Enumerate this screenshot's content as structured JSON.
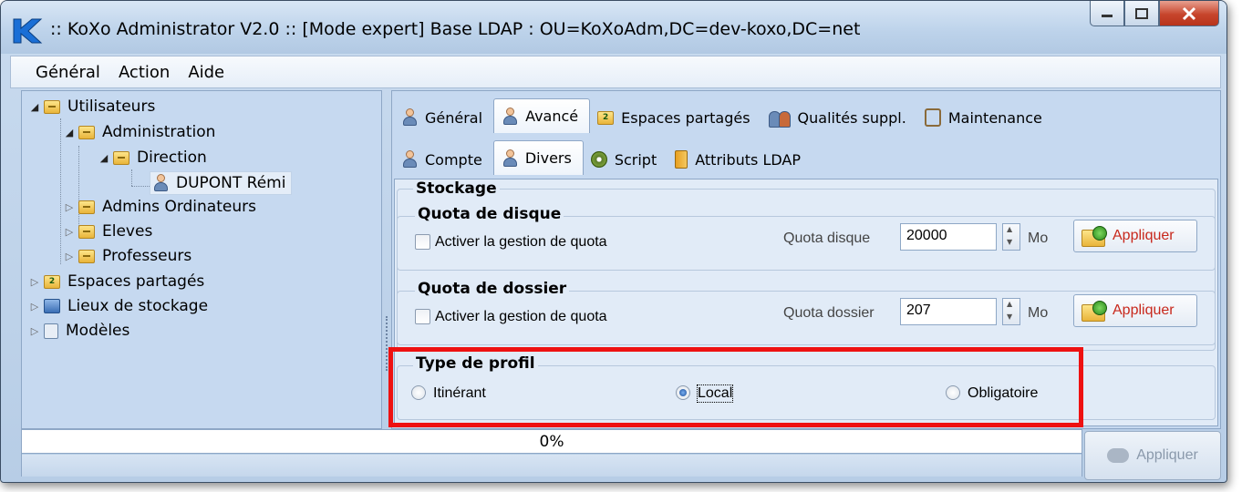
{
  "window": {
    "title": ":: KoXo Administrator V2.0 :: [Mode expert] Base LDAP : OU=KoXoAdm,DC=dev-koxo,DC=net"
  },
  "menu": [
    "Général",
    "Action",
    "Aide"
  ],
  "tree": {
    "utilisateurs": "Utilisateurs",
    "administration": "Administration",
    "direction": "Direction",
    "dupont": "DUPONT Rémi",
    "admins_ordinateurs": "Admins Ordinateurs",
    "eleves": "Eleves",
    "professeurs": "Professeurs",
    "espaces_partages": "Espaces partagés",
    "lieux_stockage": "Lieux de stockage",
    "modeles": "Modèles"
  },
  "tabs_main": [
    "Général",
    "Avancé",
    "Espaces partagés",
    "Qualités suppl.",
    "Maintenance"
  ],
  "tabs_sub": [
    "Compte",
    "Divers",
    "Script",
    "Attributs LDAP"
  ],
  "stockage": {
    "title": "Stockage",
    "quota_disque": {
      "title": "Quota de disque",
      "checkbox_label": "Activer la gestion de quota",
      "field_label": "Quota disque",
      "value": "20000",
      "unit": "Mo",
      "apply_label": "Appliquer"
    },
    "quota_dossier": {
      "title": "Quota de dossier",
      "checkbox_label": "Activer la gestion de quota",
      "field_label": "Quota dossier",
      "value": "207",
      "unit": "Mo",
      "apply_label": "Appliquer"
    }
  },
  "profil": {
    "title": "Type de profil",
    "options": [
      "Itinérant",
      "Local",
      "Obligatoire"
    ],
    "selected": "Local"
  },
  "progress": {
    "text": "0%",
    "value": 0
  },
  "main_apply_label": "Appliquer",
  "colors": {
    "highlight": "#ee1111",
    "apply_text": "#c8281c"
  }
}
